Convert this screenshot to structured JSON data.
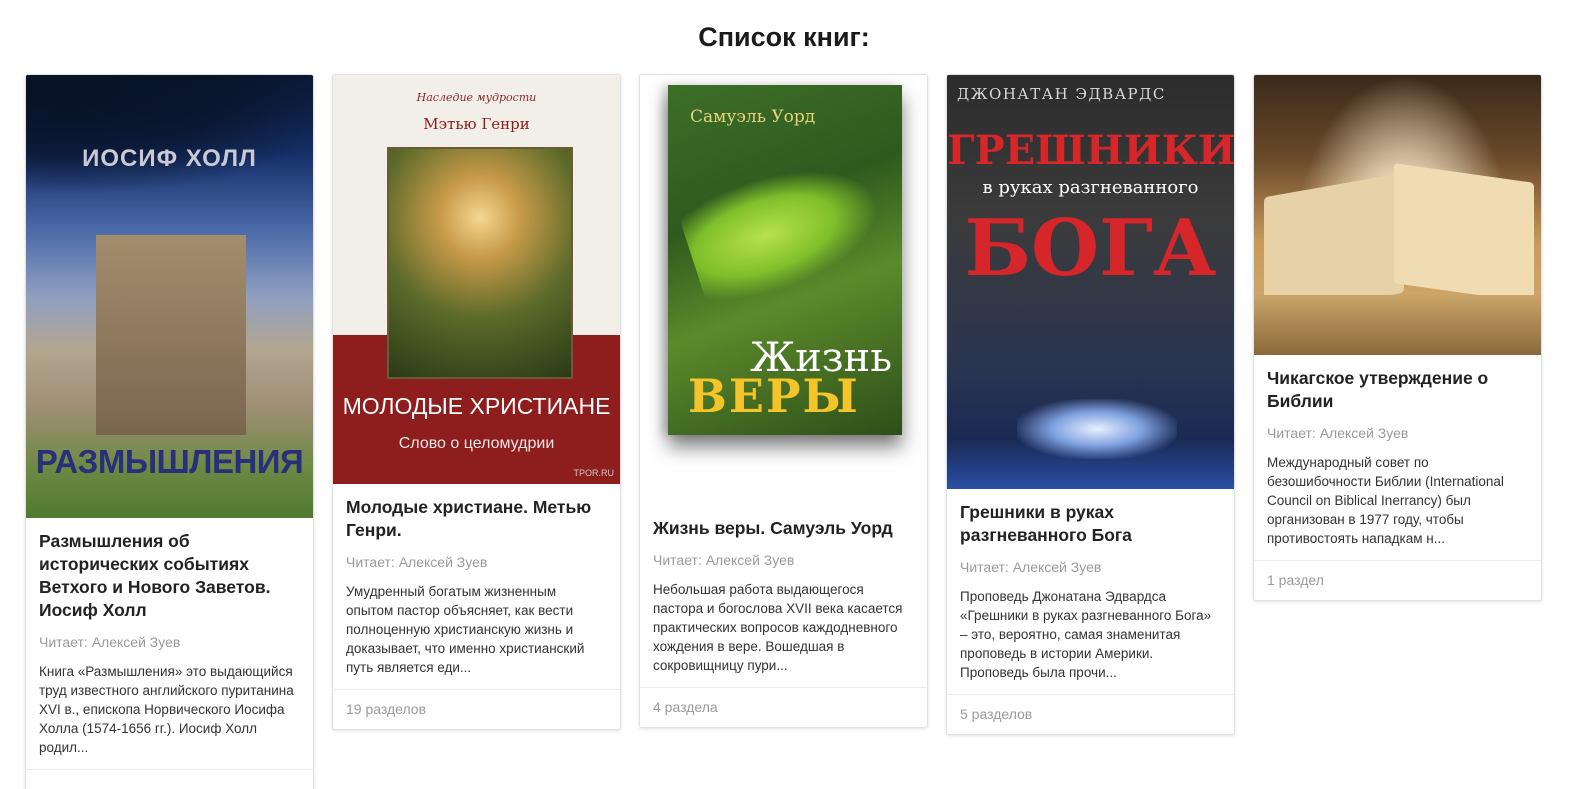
{
  "page": {
    "title": "Список книг:"
  },
  "books": [
    {
      "cover": {
        "author": "ИОСИФ ХОЛЛ",
        "title": "РАЗМЫШЛЕНИЯ"
      },
      "title": "Размышления об исторических событиях Ветхого и Нового Заветов. Иосиф Холл",
      "reader": "Читает: Алексей Зуев",
      "description": "Книга «Размышления» это выдающийся труд известного английского пуританина XVI в., епископа Норвического Иосифа Холла (1574-1656 гг.). Иосиф Холл родил...",
      "sections": ""
    },
    {
      "cover": {
        "series": "Наследие мудрости",
        "author": "Мэтью Генри",
        "title": "МОЛОДЫЕ ХРИСТИАНЕ",
        "subtitle": "Слово о целомудрии",
        "watermark": "TPOR.RU"
      },
      "title": "Молодые христиане. Метью Генри.",
      "reader": "Читает: Алексей Зуев",
      "description": "Умудренный богатым жизненным опытом пастор объясняет, как вести полноценную христианскую жизнь и доказывает, что именно христианский путь является еди...",
      "sections": "19 разделов"
    },
    {
      "cover": {
        "author": "Самуэль Уорд",
        "title_line1": "Жизнь",
        "title_line2": "ВЕРЫ"
      },
      "title": "Жизнь веры. Самуэль Уорд",
      "reader": "Читает: Алексей Зуев",
      "description": "Небольшая работа выдающегося пастора и богослова XVII века касается практических вопросов каждодневного хождения в вере. Вошедшая в сокровищницу пури...",
      "sections": "4 раздела"
    },
    {
      "cover": {
        "author": "ДЖОНАТАН ЭДВАРДС",
        "title_line1": "ГРЕШНИКИ",
        "title_line2": "в руках разгневанного",
        "title_line3": "БОГА"
      },
      "title": "Грешники в руках разгневанного Бога",
      "reader": "Читает: Алексей Зуев",
      "description": "Проповедь Джонатана Эдвардса «Грешники в руках разгневанного Бога» – это, вероятно, самая знаменитая проповедь в истории Америки. Проповедь была прочи...",
      "sections": "5 разделов"
    },
    {
      "cover": {},
      "title": "Чикагское утверждение о Библии",
      "reader": "Читает: Алексей Зуев",
      "description": "Международный совет по безошибочности Библии (International Council on Biblical Inerrancy) был организован в 1977 году, чтобы противостоять нападкам н...",
      "sections": "1 раздел"
    }
  ]
}
